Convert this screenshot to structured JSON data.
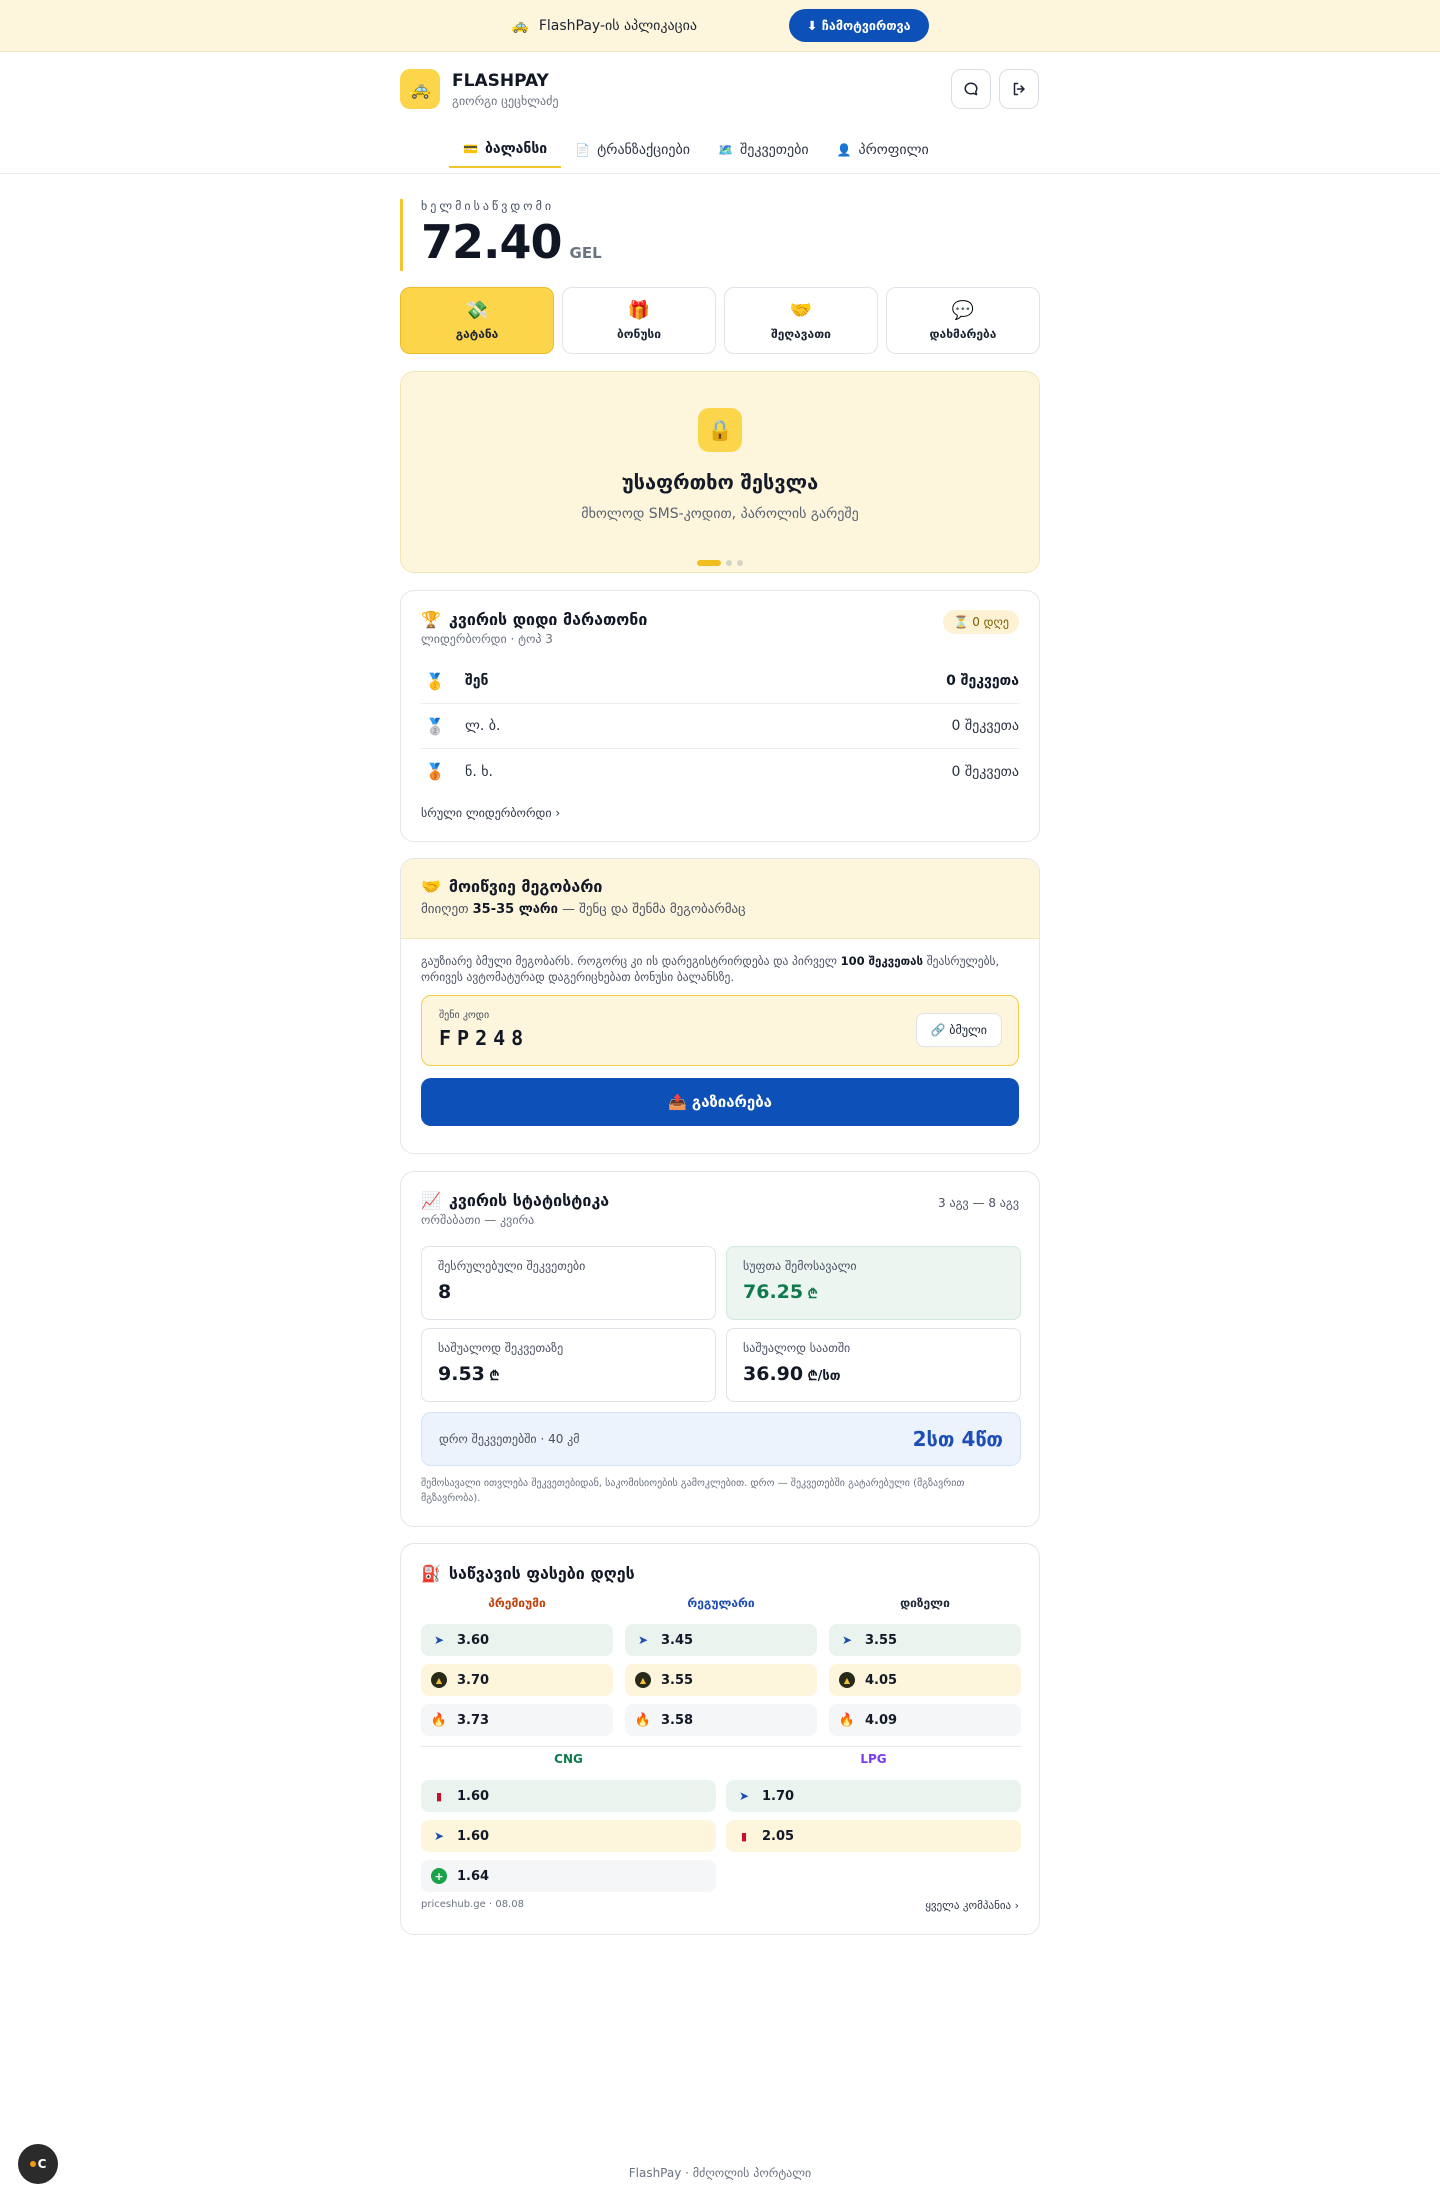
{
  "banner": {
    "emoji": "🚕",
    "text": "FlashPay-ის აპლიკაცია",
    "download_label": "⬇ ჩამოტვირთვა"
  },
  "header": {
    "logo_emoji": "🚕",
    "brand": "FLASHPAY",
    "user": "გიორგი ცეცხლაძე"
  },
  "tabs": [
    {
      "icon": "💳",
      "label": "ბალანსი",
      "active": true
    },
    {
      "icon": "📄",
      "label": "ტრანზაქციები",
      "active": false
    },
    {
      "icon": "🗺️",
      "label": "შეკვეთები",
      "active": false
    },
    {
      "icon": "👤",
      "label": "პროფილი",
      "active": false
    }
  ],
  "balance": {
    "label": "ხელმისაწვდომი",
    "amount": "72.40",
    "currency": "GEL"
  },
  "actions": [
    {
      "emoji": "💸",
      "label": "გატანა",
      "active": true
    },
    {
      "emoji": "🎁",
      "label": "ბონუსი",
      "active": false
    },
    {
      "emoji": "🤝",
      "label": "შეღავათი",
      "active": false
    },
    {
      "emoji": "💬",
      "label": "დახმარება",
      "active": false
    }
  ],
  "promo": {
    "emoji": "🔒",
    "title": "უსაფრთხო შესვლა",
    "subtitle": "მხოლოდ SMS-კოდით, პაროლის გარეშე",
    "slides": 3,
    "current": 1
  },
  "leaderboard": {
    "emoji": "🏆",
    "title": "კვირის დიდი მარათონი",
    "subtitle": "ლიდერბორდი · ტოპ 3",
    "days_badge": "⏳ 0 დღე",
    "rows": [
      {
        "medal": "🥇",
        "name": "შენ",
        "value": "0 შეკვეთა",
        "me": true
      },
      {
        "medal": "🥈",
        "name": "ლ. ბ.",
        "value": "0 შეკვეთა",
        "me": false
      },
      {
        "medal": "🥉",
        "name": "ნ. ხ.",
        "value": "0 შეკვეთა",
        "me": false
      }
    ],
    "link": "სრული ლიდერბორდი ›"
  },
  "referral": {
    "emoji": "🤝",
    "title": "მოიწვიე მეგობარი",
    "sub_pre": "მიიღეთ ",
    "sub_bold": "35-35 ლარი",
    "sub_post": " — შენც და შენმა მეგობარმაც",
    "text_pre": "გაუზიარე ბმული მეგობარს. როგორც კი ის დარეგისტრირდება და პირველ ",
    "text_bold": "100 შეკვეთას",
    "text_post": " შეასრულებს, ორივეს ავტომატურად დაგერიცხებათ ბონუსი ბალანსზე.",
    "code_label": "შენი კოდი",
    "code": "FP248",
    "copy_label": "🔗 ბმული",
    "share_label": "📤 გაზიარება"
  },
  "stats": {
    "emoji": "📈",
    "title": "კვირის სტატისტიკა",
    "subtitle": "ორშაბათი — კვირა",
    "range": "3 აგვ — 8 აგვ",
    "items": [
      {
        "label": "შესრულებული შეკვეთები",
        "value": "8",
        "unit": ""
      },
      {
        "label": "სუფთა შემოსავალი",
        "value": "76.25",
        "unit": " ₾"
      },
      {
        "label": "საშუალოდ შეკვეთაზე",
        "value": "9.53",
        "unit": " ₾"
      },
      {
        "label": "საშუალოდ საათში",
        "value": "36.90",
        "unit": " ₾/სთ"
      }
    ],
    "time_label": "დრო შეკვეთებში · 40 კმ",
    "time_value": "2სთ 4წთ",
    "note": "შემოსავალი ითვლება შეკვეთებიდან, საკომისიოების გამოკლებით. დრო — შეკვეთებში გატარებული (მგზავრით მგზავრობა)."
  },
  "fuel": {
    "emoji": "⛽",
    "title": "საწვავის ფასები დღეს",
    "columns": [
      {
        "name": "პრემიუმი",
        "color": "#c2410c",
        "cells": [
          {
            "brand": "arrow",
            "price": "3.60",
            "bg": "blue"
          },
          {
            "brand": "gulf",
            "price": "3.70",
            "bg": "yel"
          },
          {
            "brand": "fire",
            "price": "3.73",
            "bg": "gray"
          }
        ]
      },
      {
        "name": "რეგულარი",
        "color": "#1d4eb3",
        "cells": [
          {
            "brand": "arrow",
            "price": "3.45",
            "bg": "blue"
          },
          {
            "brand": "gulf",
            "price": "3.55",
            "bg": "yel"
          },
          {
            "brand": "fire",
            "price": "3.58",
            "bg": "gray"
          }
        ]
      },
      {
        "name": "დიზელი",
        "color": "#1f2937",
        "cells": [
          {
            "brand": "arrow",
            "price": "3.55",
            "bg": "blue"
          },
          {
            "brand": "gulf",
            "price": "4.05",
            "bg": "yel"
          },
          {
            "brand": "fire",
            "price": "4.09",
            "bg": "gray"
          }
        ]
      }
    ],
    "columns2": [
      {
        "name": "CNG",
        "color": "#0f7a4d",
        "cells": [
          {
            "brand": "lukoil",
            "price": "1.60",
            "bg": "blue"
          },
          {
            "brand": "arrow",
            "price": "1.60",
            "bg": "yel"
          },
          {
            "brand": "green",
            "price": "1.64",
            "bg": "gray"
          }
        ]
      },
      {
        "name": "LPG",
        "color": "#7c3aed",
        "cells": [
          {
            "brand": "arrow",
            "price": "1.70",
            "bg": "blue"
          },
          {
            "brand": "lukoil",
            "price": "2.05",
            "bg": "yel"
          }
        ]
      }
    ],
    "source": "priceshub.ge · 08.08",
    "all_link": "ყველა კომპანია ›"
  },
  "footer": "FlashPay · მძღოლის პორტალი",
  "corner": {
    "letter": "C"
  }
}
